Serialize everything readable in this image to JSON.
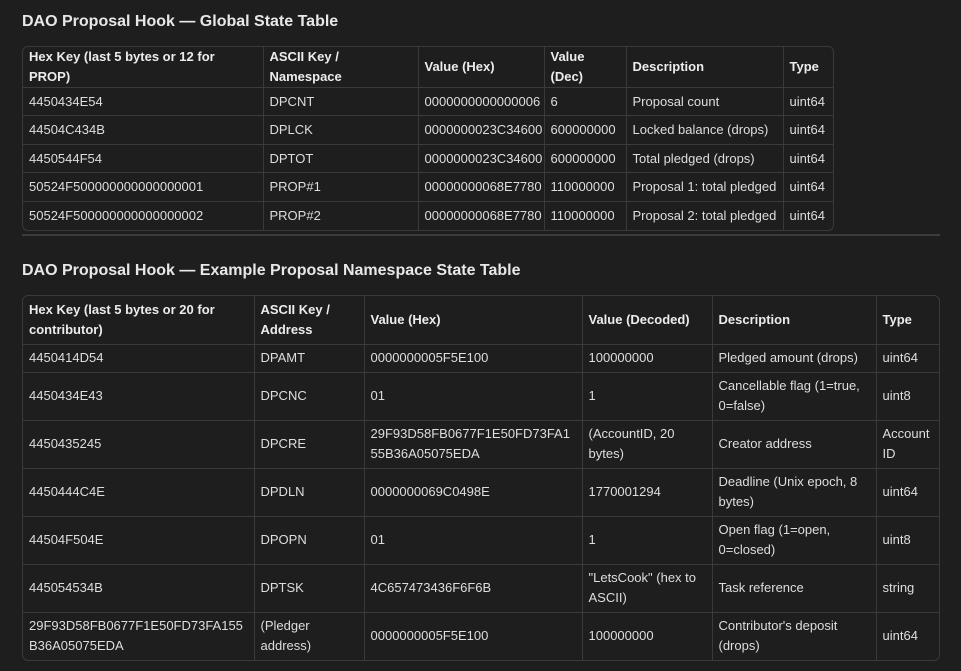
{
  "global": {
    "title": "DAO Proposal Hook — Global State Table",
    "headers": [
      "Hex Key (last 5 bytes or 12 for PROP)",
      "ASCII Key / Namespace",
      "Value (Hex)",
      "Value (Dec)",
      "Description",
      "Type"
    ],
    "rows": [
      [
        "4450434E54",
        "DPCNT",
        "0000000000000006",
        "6",
        "Proposal count",
        "uint64"
      ],
      [
        "44504C434B",
        "DPLCK",
        "0000000023C34600",
        "600000000",
        "Locked balance (drops)",
        "uint64"
      ],
      [
        "4450544F54",
        "DPTOT",
        "0000000023C34600",
        "600000000",
        "Total pledged (drops)",
        "uint64"
      ],
      [
        "50524F500000000000000001",
        "PROP#1",
        "00000000068E7780",
        "110000000",
        "Proposal 1: total pledged",
        "uint64"
      ],
      [
        "50524F500000000000000002",
        "PROP#2",
        "00000000068E7780",
        "110000000",
        "Proposal 2: total pledged",
        "uint64"
      ]
    ]
  },
  "proposal": {
    "title": "DAO Proposal Hook — Example Proposal Namespace State Table",
    "headers": [
      "Hex Key (last 5 bytes or 20 for contributor)",
      "ASCII Key / Address",
      "Value (Hex)",
      "Value (Decoded)",
      "Description",
      "Type"
    ],
    "rows": [
      [
        "4450414D54",
        "DPAMT",
        "0000000005F5E100",
        "100000000",
        "Pledged amount (drops)",
        "uint64"
      ],
      [
        "4450434E43",
        "DPCNC",
        "01",
        "1",
        "Cancellable flag (1=true, 0=false)",
        "uint8"
      ],
      [
        "4450435245",
        "DPCRE",
        "29F93D58FB0677F1E50FD73FA155B36A05075EDA",
        "(AccountID, 20 bytes)",
        "Creator address",
        "Account ID"
      ],
      [
        "445044 4C4E",
        "DPDLN",
        "0000000069C0498E",
        "1770001294",
        "Deadline (Unix epoch, 8 bytes)",
        "uint64"
      ],
      [
        "44504F504E",
        "DPOPN",
        "01",
        "1",
        "Open flag (1=open, 0=closed)",
        "uint8"
      ],
      [
        "445054534B",
        "DPTSK",
        "4C657473436F6F6B",
        "\"LetsCook\" (hex to ASCII)",
        "Task reference",
        "string"
      ],
      [
        "29F93D58FB0677F1E50FD73FA155B36A05075EDA",
        "(Pledger address)",
        "0000000005F5E100",
        "100000000",
        "Contributor's deposit (drops)",
        "uint64"
      ]
    ]
  }
}
